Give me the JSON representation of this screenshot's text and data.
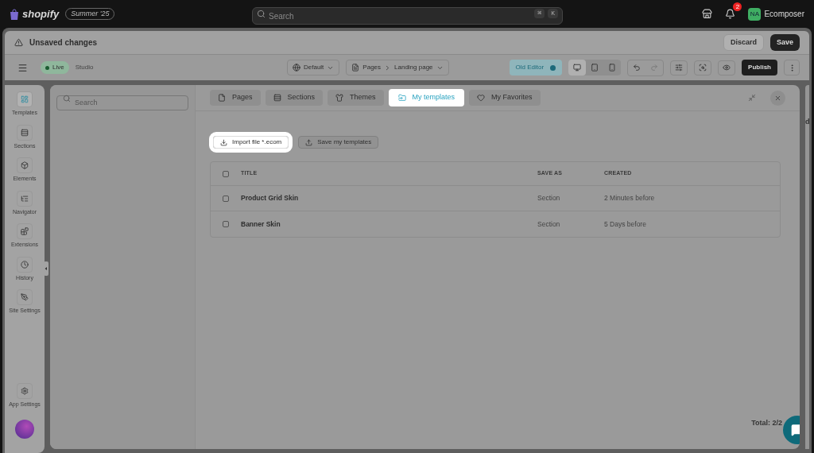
{
  "topbar": {
    "brand": "shopify",
    "edition": "Summer '25",
    "search": {
      "placeholder": "Search"
    },
    "shortcut": [
      "⌘",
      "K"
    ],
    "notification_count": "2",
    "avatar": "NA",
    "store": "Ecomposer"
  },
  "unsaved_bar": {
    "title": "Unsaved changes",
    "buttons": [
      {
        "label": "Discard",
        "kind": "secondary"
      },
      {
        "label": "Save",
        "kind": "primary"
      }
    ]
  },
  "toolbar": {
    "status": "Live",
    "mode": "Studio",
    "theme": "Default",
    "breadcrumb": [
      "Pages",
      "Landing page"
    ],
    "old_editor": {
      "label": "Old Editor",
      "on": true
    },
    "devices": [
      {
        "kind": "desktop",
        "selected": true
      },
      {
        "kind": "tablet",
        "selected": false
      },
      {
        "kind": "mobile",
        "selected": false
      }
    ],
    "publish": "Publish"
  },
  "sidebar": {
    "items": [
      {
        "label": "Templates",
        "selected": true
      },
      {
        "label": "Sections",
        "selected": false
      },
      {
        "label": "Elements",
        "selected": false
      },
      {
        "label": "Navigator",
        "selected": false
      },
      {
        "label": "Extensions",
        "selected": false
      },
      {
        "label": "History",
        "selected": false
      },
      {
        "label": "Site Settings",
        "selected": false
      }
    ],
    "bottom": {
      "label": "App Settings"
    }
  },
  "modal": {
    "search": {
      "placeholder": "Search"
    },
    "tabs": [
      {
        "label": "Pages",
        "selected": false
      },
      {
        "label": "Sections",
        "selected": false
      },
      {
        "label": "Themes",
        "selected": false
      },
      {
        "label": "My templates",
        "selected": true
      },
      {
        "label": "My Favorites",
        "selected": false
      }
    ],
    "actions": [
      {
        "label": "Import file *.ecom",
        "kind": "import",
        "highlighted": true
      },
      {
        "label": "Save my templates",
        "kind": "save",
        "highlighted": false
      }
    ],
    "table": {
      "all_checked": false,
      "columns": [
        "TITLE",
        "SAVE AS",
        "CREATED"
      ],
      "rows": [
        {
          "title": "Product Grid Skin",
          "save_as": "Section",
          "created": "2 Minutes before",
          "checked": false
        },
        {
          "title": "Banner Skin",
          "save_as": "Section",
          "created": "5 Days before",
          "checked": false
        }
      ]
    },
    "total": "Total: 2/2"
  },
  "background_fragment": "d"
}
